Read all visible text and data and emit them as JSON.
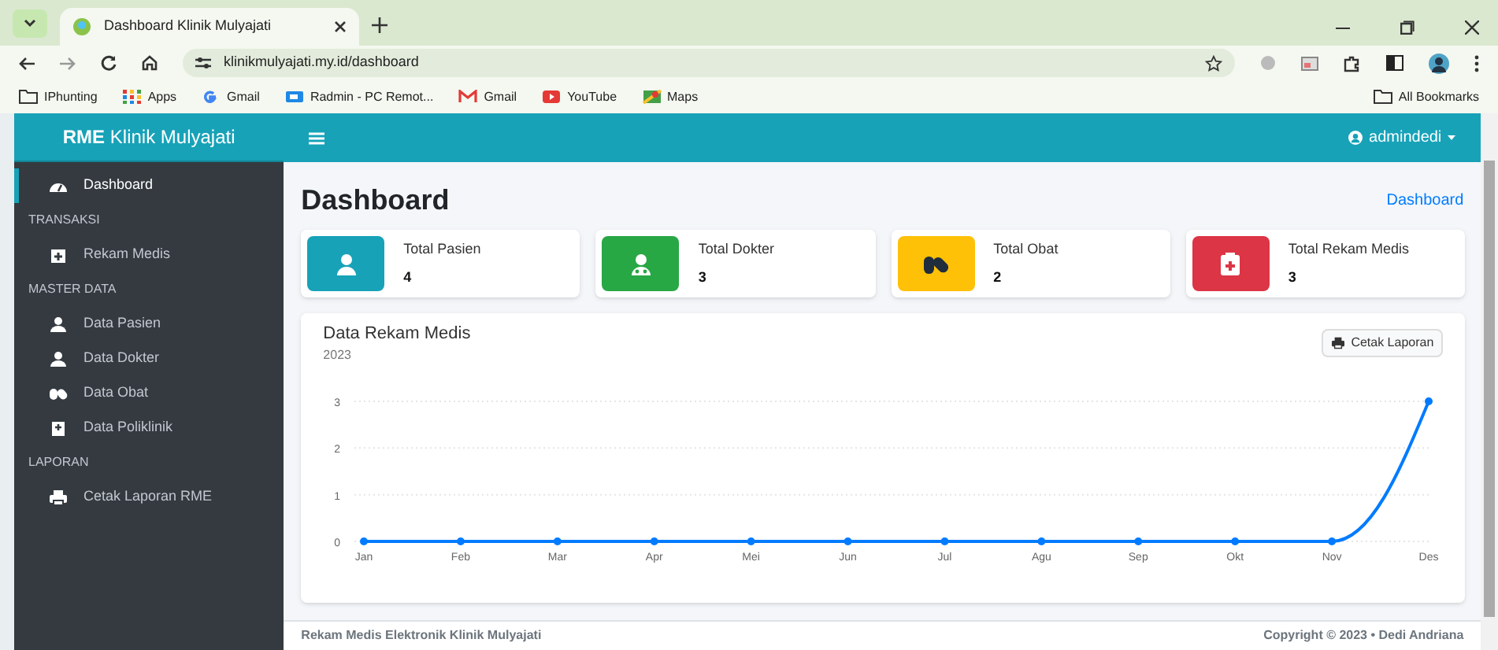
{
  "browser": {
    "tab_title": "Dashboard Klinik Mulyajati",
    "url": "klinikmulyajati.my.id/dashboard",
    "bookmarks": [
      "IPhunting",
      "Apps",
      "Gmail",
      "Radmin - PC Remot...",
      "Gmail",
      "YouTube",
      "Maps"
    ],
    "all_bookmarks": "All Bookmarks"
  },
  "navbar": {
    "brand": "**RME** Klinik Mulyajati",
    "user": "admindedi"
  },
  "sidebar": {
    "items": [
      {
        "kind": "link",
        "label": "Dashboard",
        "selected": true
      },
      {
        "kind": "header",
        "label": "TRANSAKSI"
      },
      {
        "kind": "link",
        "label": "Rekam Medis",
        "selected": false
      },
      {
        "kind": "header",
        "label": "MASTER DATA"
      },
      {
        "kind": "link",
        "label": "Data Pasien",
        "selected": false
      },
      {
        "kind": "link",
        "label": "Data Dokter",
        "selected": false
      },
      {
        "kind": "link",
        "label": "Data Obat",
        "selected": false
      },
      {
        "kind": "link",
        "label": "Data Poliklinik",
        "selected": false
      },
      {
        "kind": "header",
        "label": "LAPORAN"
      },
      {
        "kind": "link",
        "label": "Cetak Laporan RME",
        "selected": false
      }
    ]
  },
  "page": {
    "title": "Dashboard",
    "breadcrumb": "Dashboard"
  },
  "stats": [
    {
      "label": "Total Pasien",
      "value": "4",
      "color": "#17a2b8"
    },
    {
      "label": "Total Dokter",
      "value": "3",
      "color": "#28a745"
    },
    {
      "label": "Total Obat",
      "value": "2",
      "color": "#ffc107"
    },
    {
      "label": "Total Rekam Medis",
      "value": "3",
      "color": "#dc3545"
    }
  ],
  "chart_card": {
    "title": "Data Rekam Medis",
    "subtitle": "2023",
    "button": "Cetak Laporan",
    "chart_data": {
      "type": "line",
      "categories": [
        "Jan",
        "Feb",
        "Mar",
        "Apr",
        "Mei",
        "Jun",
        "Jul",
        "Agu",
        "Sep",
        "Okt",
        "Nov",
        "Des"
      ],
      "series": [
        {
          "color": "#007bff",
          "marker": true,
          "values": [
            0,
            0,
            0,
            0,
            0,
            0,
            0,
            0,
            0,
            0,
            0,
            3
          ]
        }
      ],
      "ylim": [
        0,
        3
      ],
      "yticks": [
        0,
        1,
        2,
        3
      ]
    }
  },
  "footer": {
    "left": "Rekam Medis Elektronik Klinik Mulyajati",
    "right": "Copyright © 2023 • Dedi Andriana"
  }
}
